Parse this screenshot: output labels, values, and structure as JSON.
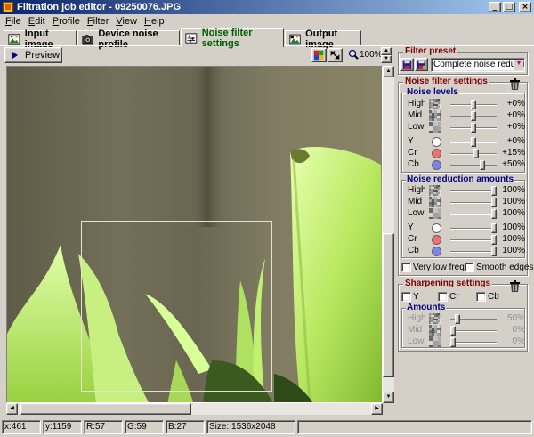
{
  "window": {
    "title": "Filtration job editor - 09250076.JPG",
    "controls": [
      "_",
      "□",
      "×"
    ]
  },
  "menu": [
    "File",
    "Edit",
    "Profile",
    "Filter",
    "View",
    "Help"
  ],
  "tabs": [
    {
      "label": "Input image",
      "icon": "input-image-icon",
      "active": false
    },
    {
      "label": "Device noise profile",
      "icon": "camera-icon",
      "active": false
    },
    {
      "label": "Noise filter settings",
      "icon": "filter-settings-icon",
      "active": true
    },
    {
      "label": "Output image",
      "icon": "output-image-icon",
      "active": false
    }
  ],
  "toolbar": {
    "preview_label": "Preview",
    "zoom_level": "100%"
  },
  "filter_preset": {
    "title": "Filter preset",
    "selected": "Complete noise reduction *"
  },
  "noise_filter": {
    "title": "Noise filter settings",
    "noise_levels": {
      "title": "Noise levels",
      "rows": [
        {
          "label": "High",
          "value": "+0%",
          "level": 0.5
        },
        {
          "label": "Mid",
          "value": "+0%",
          "level": 0.5
        },
        {
          "label": "Low",
          "value": "+0%",
          "level": 0.5
        },
        {
          "label": "Y",
          "value": "+0%",
          "level": 0.5,
          "color": "#ffffff"
        },
        {
          "label": "Cr",
          "value": "+15%",
          "level": 0.57,
          "color": "#f07070"
        },
        {
          "label": "Cb",
          "value": "+50%",
          "level": 0.72,
          "color": "#8080f0"
        }
      ]
    },
    "reduction_amounts": {
      "title": "Noise reduction amounts",
      "rows": [
        {
          "label": "High",
          "value": "100%",
          "level": 1.0
        },
        {
          "label": "Mid",
          "value": "100%",
          "level": 1.0
        },
        {
          "label": "Low",
          "value": "100%",
          "level": 1.0
        },
        {
          "label": "Y",
          "value": "100%",
          "level": 1.0,
          "color": "#ffffff"
        },
        {
          "label": "Cr",
          "value": "100%",
          "level": 1.0,
          "color": "#f07070"
        },
        {
          "label": "Cb",
          "value": "100%",
          "level": 1.0,
          "color": "#8080f0"
        }
      ]
    },
    "very_low_freq": "Very low freq",
    "smooth_edges": "Smooth edges"
  },
  "sharpening": {
    "title": "Sharpening settings",
    "channels": [
      "Y",
      "Cr",
      "Cb"
    ],
    "amounts": {
      "title": "Amounts",
      "rows": [
        {
          "label": "High",
          "value": "50%",
          "level": 0.1
        },
        {
          "label": "Mid",
          "value": "0%",
          "level": 0.0
        },
        {
          "label": "Low",
          "value": "0%",
          "level": 0.0
        }
      ]
    }
  },
  "status": {
    "x": "x:461",
    "y": "y:1159",
    "r": "R:57",
    "g": "G:59",
    "b": "B:27",
    "size": "Size: 1536x2048"
  }
}
